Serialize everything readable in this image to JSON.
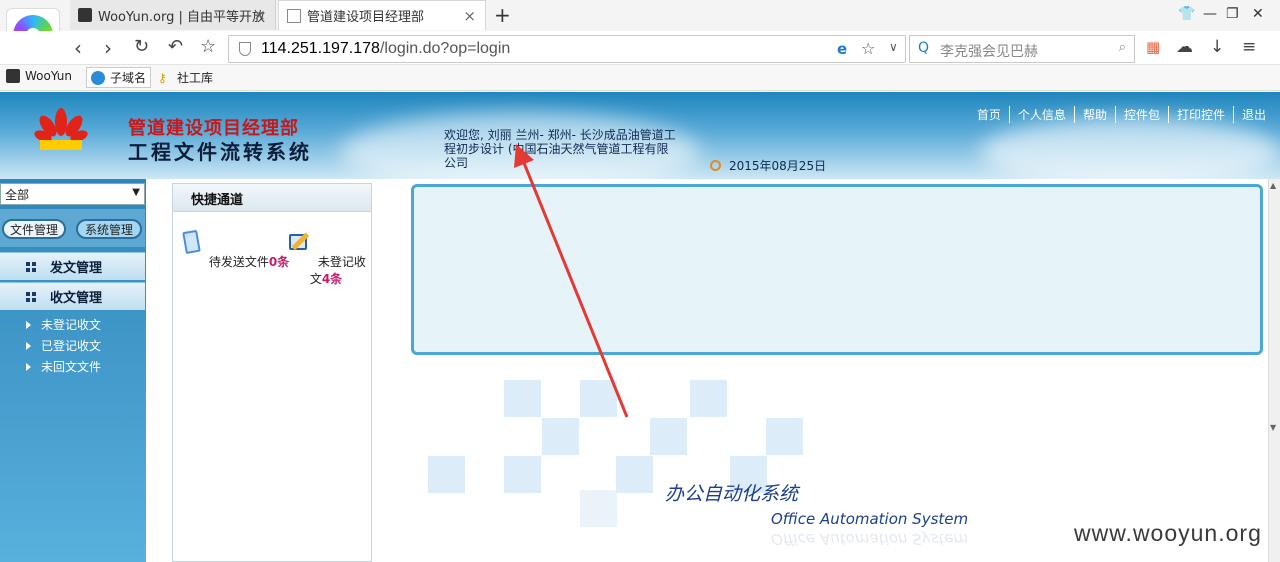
{
  "browser": {
    "tabs": [
      {
        "title": "WooYun.org | 自由平等开放"
      },
      {
        "title": "管道建设项目经理部"
      }
    ],
    "new_tab": "+",
    "url_host": "114.251.197.178",
    "url_path": "/login.do?op=login",
    "search_query": "李克强会见巴赫",
    "bookmarks": [
      "WooYun",
      "子域名",
      "社工库"
    ]
  },
  "header": {
    "org_name": "管道建设项目经理部",
    "system_title": "工程文件流转系统",
    "welcome_text": "欢迎您, 刘丽   兰州- 郑州- 长沙成品油管道工程初步设计 (中国石油天然气管道工程有限公司",
    "date": "2015年08月25日",
    "nav": [
      "首页",
      "个人信息",
      "帮助",
      "控件包",
      "打印控件",
      "退出"
    ]
  },
  "sidebar": {
    "select_value": "全部",
    "tabs": [
      "文件管理",
      "系统管理"
    ],
    "sections": [
      "发文管理",
      "收文管理"
    ],
    "submenu": [
      "未登记收文",
      "已登记收文",
      "未回文文件"
    ]
  },
  "quick": {
    "title": "快捷通道",
    "items": [
      {
        "label": "待发送文件",
        "count": "0条"
      },
      {
        "label": "未登记收文",
        "count": "4条"
      }
    ]
  },
  "main": {
    "oa_cn": "办公自动化系统",
    "oa_en": "Office Automation System"
  },
  "watermark": "www.wooyun.org",
  "colors": {
    "header_blue": "#1f86bd",
    "count_red": "#c31d6b",
    "title_red": "#c5191c",
    "arrow_red": "#e53935"
  }
}
